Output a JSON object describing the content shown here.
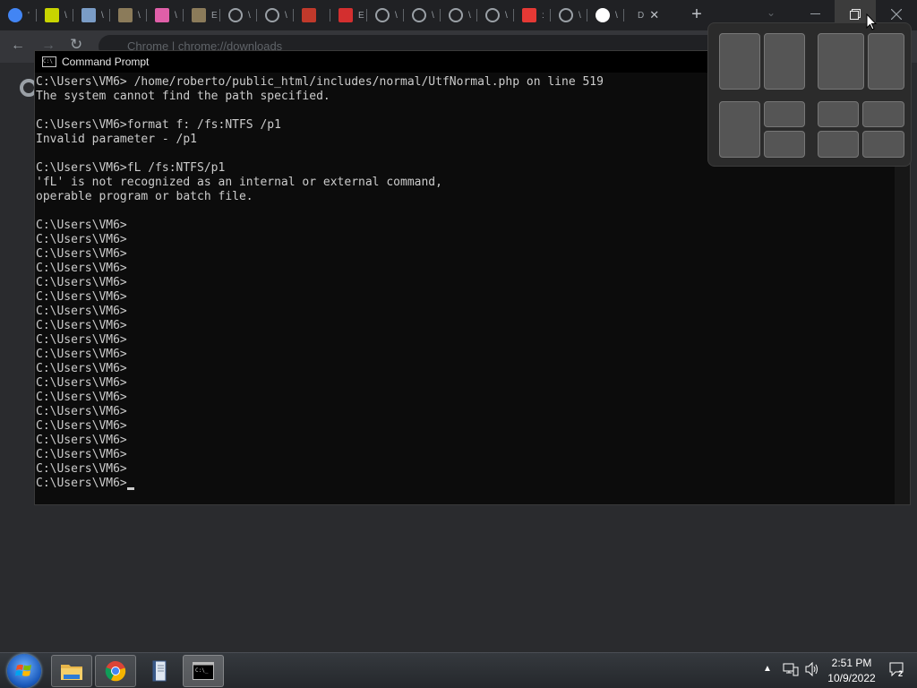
{
  "browser": {
    "tabs": [
      {
        "icon": "google-icon",
        "color": "#4285f4",
        "char": "'"
      },
      {
        "icon": "site-icon",
        "color": "#c8d400",
        "char": "\\"
      },
      {
        "icon": "site-icon",
        "color": "#7a9cc6",
        "char": "\\"
      },
      {
        "icon": "site-icon",
        "color": "#8b7b5a",
        "char": "\\"
      },
      {
        "icon": "site-icon",
        "color": "#e05fa8",
        "char": "\\"
      },
      {
        "icon": "site-icon",
        "color": "#8b7b5a",
        "char": "E"
      },
      {
        "icon": "globe-icon",
        "color": "#9aa0a6",
        "char": "\\"
      },
      {
        "icon": "globe-icon",
        "color": "#9aa0a6",
        "char": "\\"
      },
      {
        "icon": "site-icon",
        "color": "#c0392b",
        "char": ""
      },
      {
        "icon": "site-icon",
        "color": "#d32f2f",
        "char": "E"
      },
      {
        "icon": "globe-icon",
        "color": "#9aa0a6",
        "char": "\\"
      },
      {
        "icon": "globe-icon",
        "color": "#9aa0a6",
        "char": "\\"
      },
      {
        "icon": "globe-icon",
        "color": "#9aa0a6",
        "char": "\\"
      },
      {
        "icon": "globe-icon",
        "color": "#9aa0a6",
        "char": "\\"
      },
      {
        "icon": "site-icon",
        "color": "#e53935",
        "char": ":"
      },
      {
        "icon": "globe-icon",
        "color": "#9aa0a6",
        "char": "\\"
      },
      {
        "icon": "github-icon",
        "color": "#ffffff",
        "char": "\\"
      },
      {
        "icon": "download-icon",
        "color": "#9aa0a6",
        "char": "D",
        "active": true,
        "close": "✕"
      }
    ],
    "new_tab": "+",
    "tab_search": "⌄",
    "omnibox_text": "Chrome  |  chrome://downloads"
  },
  "cmd": {
    "title": "Command Prompt",
    "lines": [
      "C:\\Users\\VM6> /home/roberto/public_html/includes/normal/UtfNormal.php on line 519",
      "The system cannot find the path specified.",
      "",
      "C:\\Users\\VM6>format f: /fs:NTFS /p1",
      "Invalid parameter - /p1",
      "",
      "C:\\Users\\VM6>fL /fs:NTFS/p1",
      "'fL' is not recognized as an internal or external command,",
      "operable program or batch file.",
      "",
      "C:\\Users\\VM6>",
      "C:\\Users\\VM6>",
      "C:\\Users\\VM6>",
      "C:\\Users\\VM6>",
      "C:\\Users\\VM6>",
      "C:\\Users\\VM6>",
      "C:\\Users\\VM6>",
      "C:\\Users\\VM6>",
      "C:\\Users\\VM6>",
      "C:\\Users\\VM6>",
      "C:\\Users\\VM6>",
      "C:\\Users\\VM6>",
      "C:\\Users\\VM6>",
      "C:\\Users\\VM6>",
      "C:\\Users\\VM6>",
      "C:\\Users\\VM6>",
      "C:\\Users\\VM6>",
      "C:\\Users\\VM6>",
      "C:\\Users\\VM6>"
    ],
    "prompt": "C:\\Users\\VM6>"
  },
  "snap_layouts": {
    "layouts": [
      "two-halves",
      "two-thirds-left-one-third-right",
      "one-left-two-right",
      "four-quadrants"
    ]
  },
  "taskbar": {
    "apps": [
      "windows-explorer",
      "google-chrome",
      "notepad-book",
      "command-prompt"
    ],
    "clock_time": "2:51 PM",
    "clock_date": "10/9/2022",
    "notification_count": "2"
  }
}
